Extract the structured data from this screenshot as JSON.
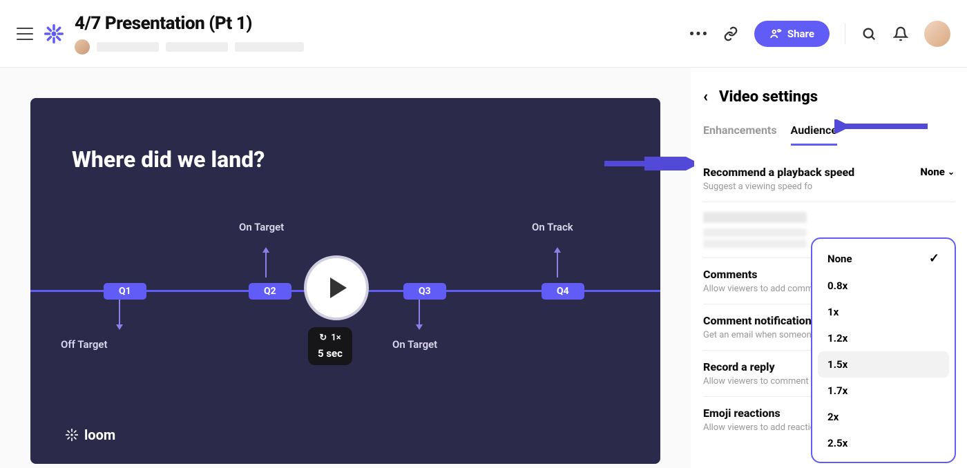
{
  "header": {
    "title": "4/7 Presentation (Pt 1)",
    "share_label": "Share"
  },
  "video": {
    "slide_title": "Where did we land?",
    "q_labels": [
      "Q1",
      "Q2",
      "Q3",
      "Q4"
    ],
    "track_labels": {
      "q1": "Off Target",
      "q2": "On Target",
      "q3": "On Target",
      "q4": "On Track"
    },
    "playback_rate": "1×",
    "duration": "5 sec",
    "watermark": "loom"
  },
  "settings": {
    "title": "Video settings",
    "tabs": {
      "enhancements": "Enhancements",
      "audience": "Audience"
    },
    "playback": {
      "label": "Recommend a playback speed",
      "desc": "Suggest a viewing speed fo",
      "current": "None"
    },
    "comments": {
      "label": "Comments",
      "desc": "Allow viewers to add comm"
    },
    "comment_notif": {
      "label": "Comment notification",
      "desc": "Get an email when someon"
    },
    "record_reply": {
      "label": "Record a reply",
      "desc": "Allow viewers to comment"
    },
    "emoji": {
      "label": "Emoji reactions",
      "desc": "Allow viewers to add reactions"
    }
  },
  "dropdown": {
    "options": [
      "None",
      "0.8x",
      "1x",
      "1.2x",
      "1.5x",
      "1.7x",
      "2x",
      "2.5x"
    ],
    "selected": "None",
    "hover": "1.5x"
  }
}
